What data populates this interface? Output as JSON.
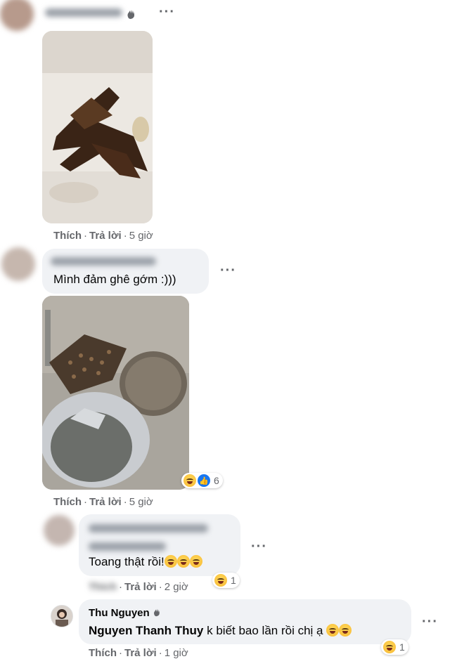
{
  "comments": [
    {
      "author": "",
      "text": "",
      "actions": {
        "like": "Thích",
        "reply": "Trả lời",
        "time": "5 giờ"
      }
    },
    {
      "author": "",
      "text": "Mình đảm ghê gớm :)))",
      "actions": {
        "like": "Thích",
        "reply": "Trả lời",
        "time": "5 giờ"
      },
      "reaction_count": "6"
    },
    {
      "author": "",
      "text": "Toang thật rồi!",
      "actions": {
        "like": "Thích",
        "reply": "Trả lời",
        "time": "2 giờ"
      },
      "reaction_count": "1"
    },
    {
      "author": "Thu Nguyen",
      "mention": "Nguyen Thanh Thuy",
      "text": " k biết bao lần rồi chị ạ",
      "actions": {
        "like": "Thích",
        "reply": "Trả lời",
        "time": "1 giờ"
      },
      "reaction_count": "1"
    }
  ],
  "icons": {
    "more": "more-options-icon",
    "wave": "waving-hand-icon",
    "laugh": "laughing-emoji-icon",
    "like": "like-icon"
  },
  "colors": {
    "bubble": "#f0f2f5",
    "meta": "#65676b",
    "like_blue": "#1877f2"
  }
}
